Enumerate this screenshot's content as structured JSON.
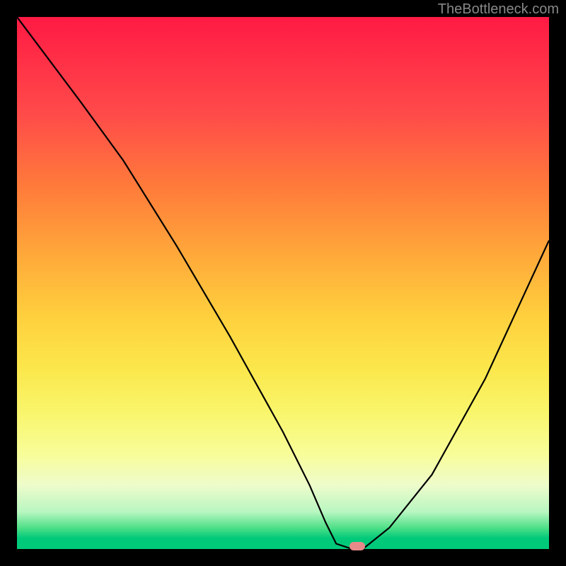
{
  "attribution": "TheBottleneck.com",
  "chart_data": {
    "type": "line",
    "title": "",
    "xlabel": "",
    "ylabel": "",
    "xlim": [
      0,
      100
    ],
    "ylim": [
      0,
      100
    ],
    "series": [
      {
        "name": "bottleneck-curve",
        "x": [
          0,
          6,
          12,
          20,
          30,
          40,
          50,
          55,
          58,
          60,
          63,
          65,
          70,
          78,
          88,
          100
        ],
        "y": [
          100,
          92,
          84,
          73,
          57,
          40,
          22,
          12,
          5,
          1,
          0,
          0,
          4,
          14,
          32,
          58
        ]
      }
    ],
    "marker": {
      "x": 64,
      "y": 0.5,
      "color": "#e98a8a"
    },
    "gradient_stops": [
      {
        "pct": 0,
        "color": "#ff1a44"
      },
      {
        "pct": 18,
        "color": "#ff4a4a"
      },
      {
        "pct": 32,
        "color": "#ff7b3a"
      },
      {
        "pct": 44,
        "color": "#ffa63a"
      },
      {
        "pct": 56,
        "color": "#ffcf3d"
      },
      {
        "pct": 66,
        "color": "#fbe74b"
      },
      {
        "pct": 74,
        "color": "#f9f56a"
      },
      {
        "pct": 82,
        "color": "#f8fd98"
      },
      {
        "pct": 88,
        "color": "#eefccb"
      },
      {
        "pct": 93,
        "color": "#b9f6c1"
      },
      {
        "pct": 96,
        "color": "#4fe088"
      },
      {
        "pct": 98,
        "color": "#00c97a"
      },
      {
        "pct": 100,
        "color": "#00c97a"
      }
    ]
  }
}
